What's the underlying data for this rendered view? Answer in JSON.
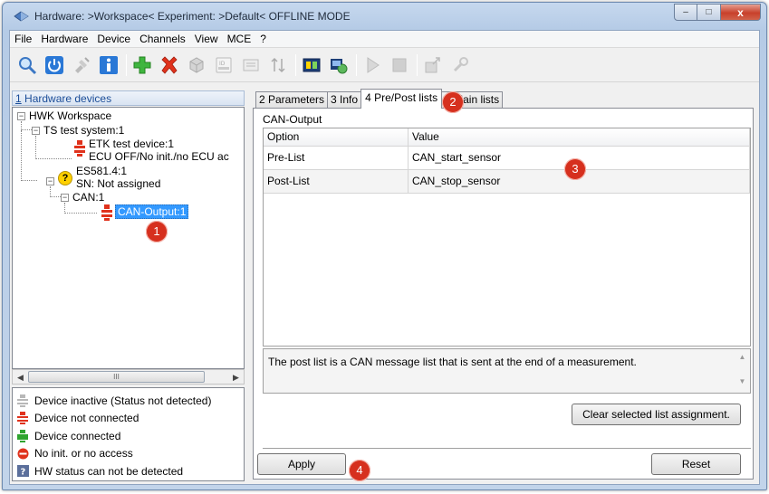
{
  "window": {
    "title": "Hardware: >Workspace<  Experiment: >Default<  OFFLINE MODE",
    "minimize": "–",
    "maximize": "□",
    "close": "x"
  },
  "menu": [
    "File",
    "Hardware",
    "Device",
    "Channels",
    "View",
    "MCE",
    "?"
  ],
  "toolbar": [
    "search-icon",
    "power-icon",
    "connect-plug-icon",
    "info-icon",
    "add-icon",
    "delete-icon",
    "cube-icon",
    "id-icon",
    "properties-icon",
    "sort-icon",
    "module-icon",
    "network-icon",
    "play-icon",
    "stop-icon",
    "export-icon",
    "tools-icon"
  ],
  "left_panel": {
    "header_num": "1",
    "header_text": " Hardware devices",
    "tree": {
      "root": "HWK Workspace",
      "ts": "TS test system:1",
      "etk": "ETK test device:1",
      "ecu": "ECU OFF/No init./no ECU ac",
      "es": "ES581.4:1",
      "sn": "SN: Not assigned",
      "can": "CAN:1",
      "can_output": "CAN-Output:1"
    },
    "scroll_grip": "III",
    "legend": [
      {
        "icon": "grey-plug-icon",
        "text": "Device inactive (Status not detected)"
      },
      {
        "icon": "red-plug-icon",
        "text": "Device not connected"
      },
      {
        "icon": "green-plug-icon",
        "text": "Device connected"
      },
      {
        "icon": "no-access-icon",
        "text": "No init. or no access"
      },
      {
        "icon": "question-icon",
        "text": "HW status can not be detected"
      }
    ]
  },
  "tabs": [
    "2 Parameters",
    "3 Info",
    "4 Pre/Post lists",
    "5 Main lists"
  ],
  "active_tab": "4 Pre/Post lists",
  "content": {
    "group_title": "CAN-Output",
    "columns": [
      "Option",
      "Value"
    ],
    "rows": [
      {
        "option": "Pre-List",
        "value": "CAN_start_sensor"
      },
      {
        "option": "Post-List",
        "value": "CAN_stop_sensor"
      }
    ],
    "description": "The post list is a CAN message list that is sent at the end of a measurement.",
    "clear_button": "Clear selected list assignment.",
    "apply_button": "Apply",
    "reset_button": "Reset"
  },
  "markers": [
    "1",
    "2",
    "3",
    "4"
  ],
  "colors": {
    "marker": "#d6301e",
    "selection": "#3399ff",
    "link": "#1b4d98"
  }
}
